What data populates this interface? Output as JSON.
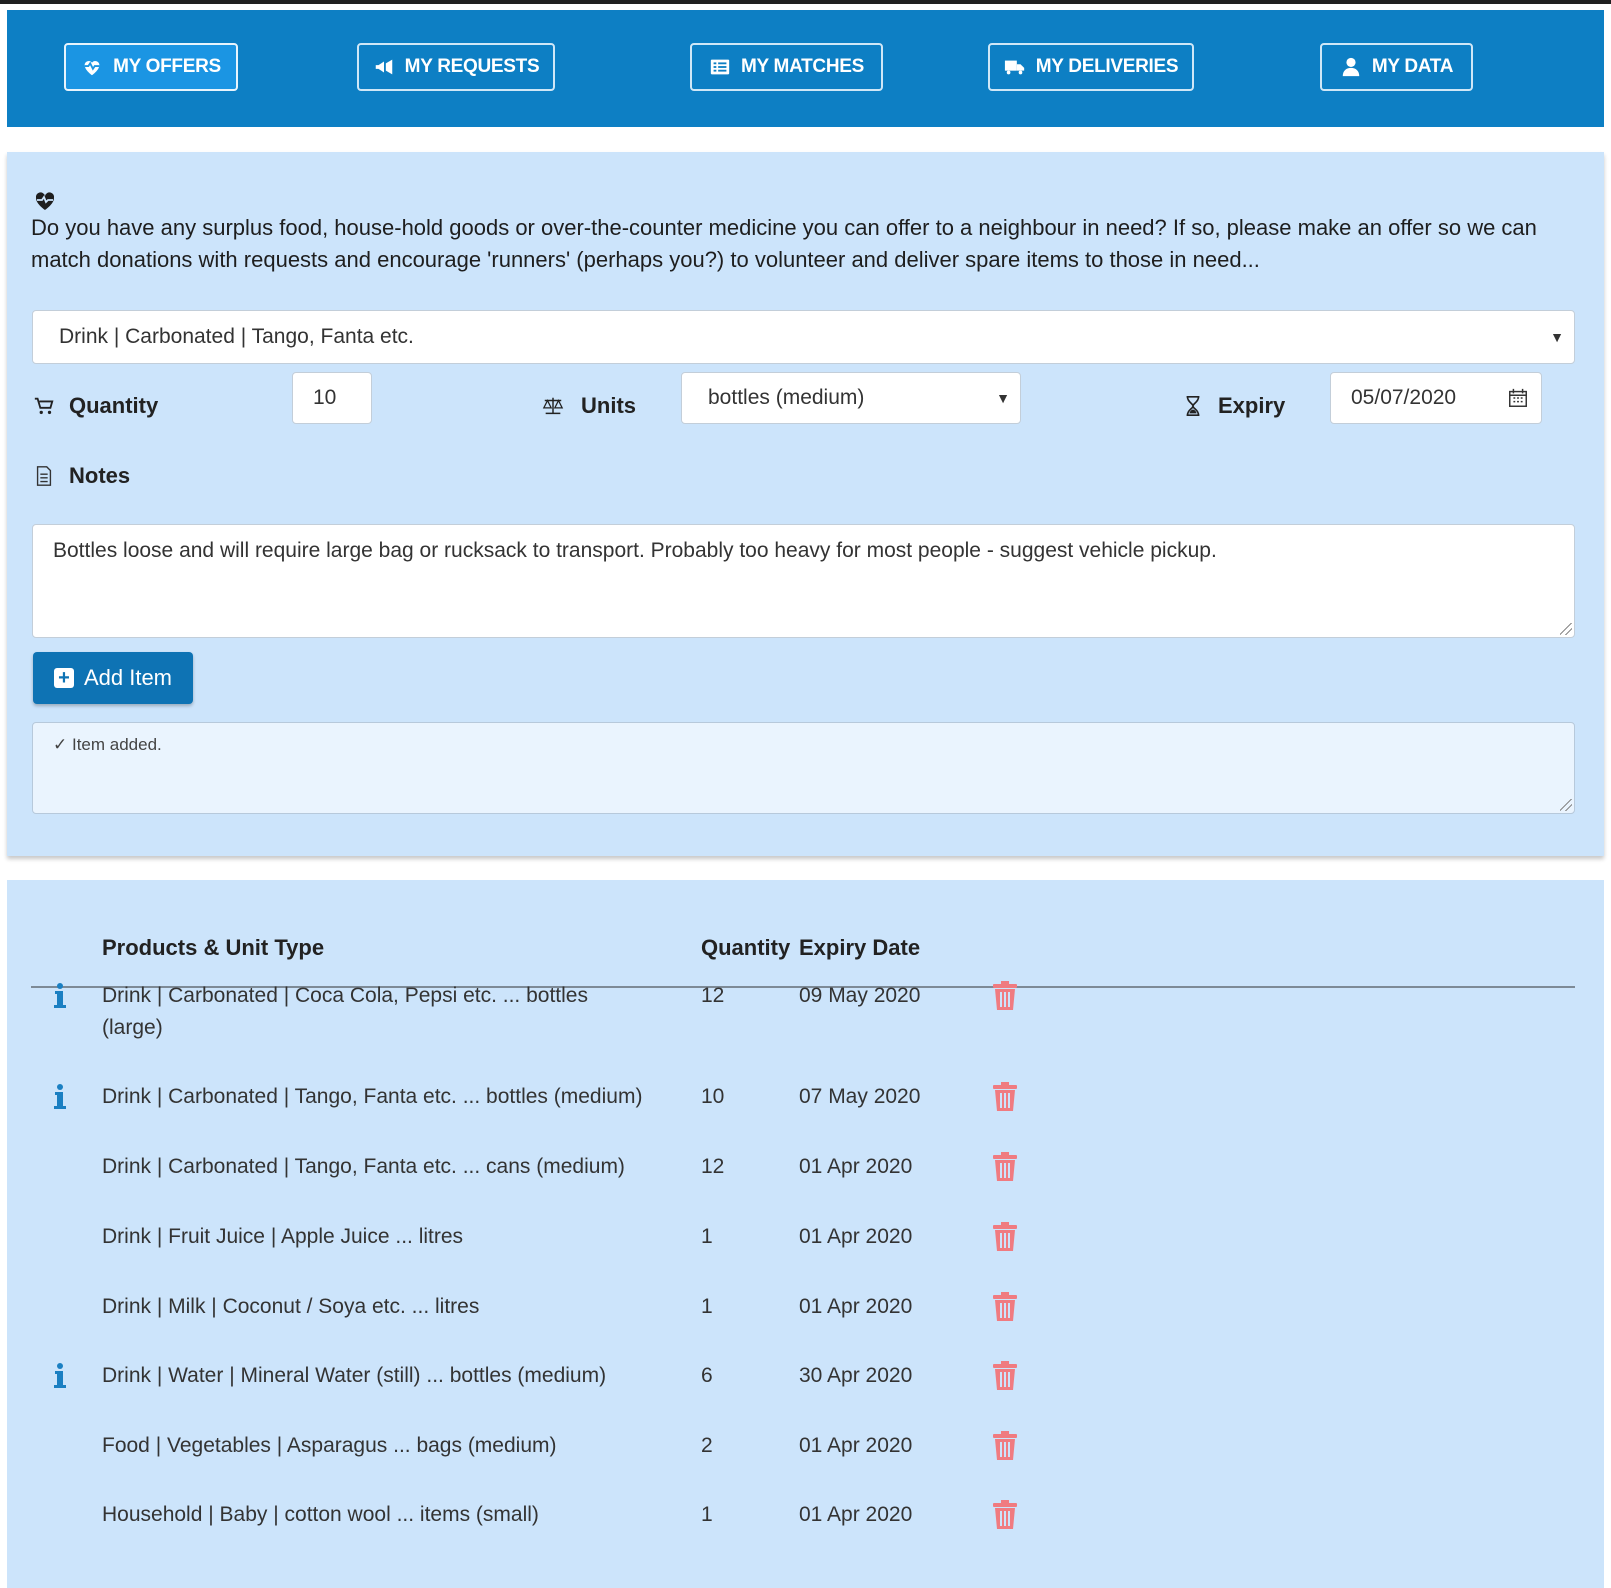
{
  "nav": {
    "items": [
      {
        "label": "MY OFFERS",
        "icon": "heart-pulse-icon",
        "active": true
      },
      {
        "label": "MY REQUESTS",
        "icon": "megaphone-icon",
        "active": false
      },
      {
        "label": "MY MATCHES",
        "icon": "list-icon",
        "active": false
      },
      {
        "label": "MY DELIVERIES",
        "icon": "truck-icon",
        "active": false
      },
      {
        "label": "MY DATA",
        "icon": "user-icon",
        "active": false
      }
    ]
  },
  "form": {
    "intro": "Do you have any surplus food, house-hold goods or over-the-counter medicine you can offer to a neighbour in need?  If so, please make an offer so we can match donations with requests and encourage 'runners' (perhaps you?) to volunteer and deliver spare items to those in need...",
    "product_selected": "Drink | Carbonated | Tango, Fanta etc.",
    "quantity_label": "Quantity",
    "quantity_value": "10",
    "units_label": "Units",
    "units_selected": "bottles (medium)",
    "expiry_label": "Expiry",
    "expiry_value": "05/07/2020",
    "notes_label": "Notes",
    "notes_value": "Bottles loose and will require large bag or rucksack to transport.  Probably too heavy for most people - suggest vehicle pickup.",
    "add_button": "Add Item",
    "status_message": "✓ Item added."
  },
  "table": {
    "headers": {
      "product": "Products & Unit Type",
      "quantity": "Quantity",
      "expiry": "Expiry Date"
    },
    "rows": [
      {
        "product": "Drink | Carbonated | Coca Cola, Pepsi etc. ... bottles (large)",
        "product_line1": "Drink | Carbonated | Coca Cola, Pepsi etc. ... bottles",
        "product_line2": "(large)",
        "quantity": "12",
        "expiry": "09 May 2020",
        "info": true
      },
      {
        "product": "Drink | Carbonated | Tango, Fanta etc. ... bottles (medium)",
        "quantity": "10",
        "expiry": "07 May 2020",
        "info": true
      },
      {
        "product": "Drink | Carbonated | Tango, Fanta etc. ... cans (medium)",
        "quantity": "12",
        "expiry": "01 Apr 2020",
        "info": false
      },
      {
        "product": "Drink | Fruit Juice | Apple Juice ... litres",
        "quantity": "1",
        "expiry": "01 Apr 2020",
        "info": false
      },
      {
        "product": "Drink | Milk | Coconut / Soya etc. ... litres",
        "quantity": "1",
        "expiry": "01 Apr 2020",
        "info": false
      },
      {
        "product": "Drink | Water | Mineral Water (still) ... bottles (medium)",
        "quantity": "6",
        "expiry": "30 Apr 2020",
        "info": true
      },
      {
        "product": "Food | Vegetables | Asparagus ... bags (medium)",
        "quantity": "2",
        "expiry": "01 Apr 2020",
        "info": false
      },
      {
        "product": "Household | Baby | cotton wool ... items (small)",
        "quantity": "1",
        "expiry": "01 Apr 2020",
        "info": false
      }
    ]
  },
  "colors": {
    "nav_bg": "#0d7fc4",
    "panel_bg": "#cce4fb",
    "info_icon": "#1a7fc2",
    "trash_icon": "#f07b80",
    "add_button": "#0e73b4"
  }
}
